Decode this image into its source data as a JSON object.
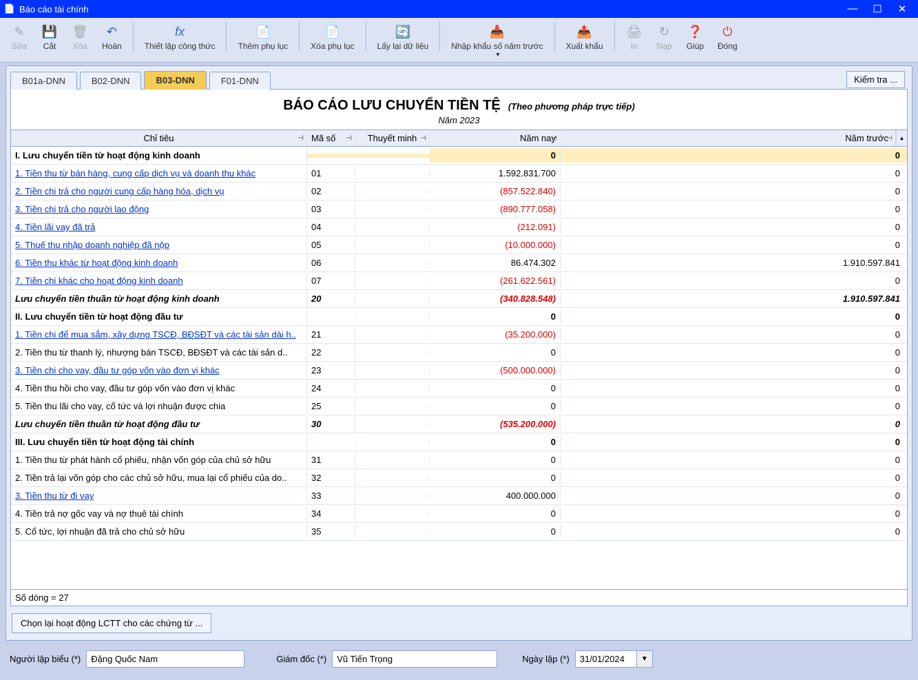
{
  "window": {
    "title": "Báo cáo tài chính"
  },
  "toolbar": {
    "edit": "Sửa",
    "cut": "Cắt",
    "del": "Xóa",
    "undo": "Hoàn",
    "formula": "Thiết lập công thức",
    "addapp": "Thêm phụ lục",
    "delapp": "Xóa phụ lục",
    "refresh": "Lấy lại dữ liệu",
    "importprev": "Nhập khẩu số năm trước",
    "export": "Xuất khẩu",
    "print": "In",
    "reload": "Nạp",
    "help": "Giúp",
    "close": "Đóng"
  },
  "tabs": {
    "t0": "B01a-DNN",
    "t1": "B02-DNN",
    "t2": "B03-DNN",
    "t3": "F01-DNN",
    "check": "Kiểm tra ..."
  },
  "report": {
    "title": "BÁO CÁO LƯU CHUYỂN TIỀN TỆ",
    "subtitle": "(Theo phương pháp trực tiếp)",
    "year": "Năm 2023"
  },
  "cols": {
    "c1": "Chỉ tiêu",
    "c2": "Mã số",
    "c3": "Thuyết minh",
    "c4": "Năm nay",
    "c5": "Năm trước"
  },
  "rows": [
    {
      "t": "I. Lưu chuyển tiền từ hoạt động kinh doanh",
      "n": "0",
      "p": "0",
      "hdr": true,
      "hl": true
    },
    {
      "t": "1. Tiền thu từ bán hàng, cung cấp dịch vụ và doanh thu khác",
      "m": "01",
      "n": "1.592.831.700",
      "p": "0",
      "link": true
    },
    {
      "t": "2. Tiền chi trả cho người cung cấp hàng hóa, dịch vụ",
      "m": "02",
      "n": "(857.522.840)",
      "p": "0",
      "link": true,
      "neg": true
    },
    {
      "t": "3. Tiền chi trả cho người lao động",
      "m": "03",
      "n": "(890.777.058)",
      "p": "0",
      "link": true,
      "neg": true
    },
    {
      "t": "4. Tiền lãi vay đã trả",
      "m": "04",
      "n": "(212.091)",
      "p": "0",
      "link": true,
      "neg": true
    },
    {
      "t": "5. Thuế thu nhập doanh nghiệp đã nộp",
      "m": "05",
      "n": "(10.000.000)",
      "p": "0",
      "link": true,
      "neg": true
    },
    {
      "t": "6. Tiền thu khác từ hoạt động kinh doanh",
      "m": "06",
      "n": "86.474.302",
      "p": "1.910.597.841",
      "link": true
    },
    {
      "t": "7. Tiền chi khác cho hoạt động kinh doanh",
      "m": "07",
      "n": "(261.622.561)",
      "p": "0",
      "link": true,
      "neg": true
    },
    {
      "t": "Lưu chuyển tiền thuần từ hoạt động kinh doanh",
      "m": "20",
      "n": "(340.828.548)",
      "p": "1.910.597.841",
      "sub": true,
      "neg": true
    },
    {
      "t": "II. Lưu chuyển tiền từ hoạt động đầu tư",
      "n": "0",
      "p": "0",
      "hdr": true
    },
    {
      "t": "1. Tiền chi để mua sắm, xây dựng TSCĐ, BĐSĐT và các tài sản dài h..",
      "m": "21",
      "n": "(35.200.000)",
      "p": "0",
      "link": true,
      "neg": true
    },
    {
      "t": "2. Tiền thu từ thanh lý, nhượng bán TSCĐ, BĐSĐT và các tài sản d..",
      "m": "22",
      "n": "0",
      "p": "0"
    },
    {
      "t": "3. Tiền chi cho vay, đầu tư góp vốn vào đơn vị khác",
      "m": "23",
      "n": "(500.000.000)",
      "p": "0",
      "link": true,
      "neg": true
    },
    {
      "t": "4. Tiền thu hồi cho vay, đầu tư góp vốn vào đơn vị khác",
      "m": "24",
      "n": "0",
      "p": "0"
    },
    {
      "t": "5. Tiền thu lãi cho vay, cổ tức và lợi nhuận được chia",
      "m": "25",
      "n": "0",
      "p": "0"
    },
    {
      "t": "Lưu chuyển tiền thuần từ hoạt động đầu tư",
      "m": "30",
      "n": "(535.200.000)",
      "p": "0",
      "sub": true,
      "neg": true
    },
    {
      "t": "III. Lưu chuyển tiền từ hoạt động tài chính",
      "n": "0",
      "p": "0",
      "hdr": true
    },
    {
      "t": "1. Tiền thu từ phát hành cổ phiếu, nhận vốn góp của chủ sở hữu",
      "m": "31",
      "n": "0",
      "p": "0"
    },
    {
      "t": "2. Tiền trả lại vốn góp cho các chủ sở hữu, mua lại cổ phiếu của do..",
      "m": "32",
      "n": "0",
      "p": "0"
    },
    {
      "t": "3. Tiền thu từ đi vay",
      "m": "33",
      "n": "400.000.000",
      "p": "0",
      "link": true
    },
    {
      "t": "4. Tiền trả nợ gốc vay và nợ thuê tài chính",
      "m": "34",
      "n": "0",
      "p": "0"
    },
    {
      "t": "5. Cổ tức, lợi nhuận đã trả cho chủ sở hữu",
      "m": "35",
      "n": "0",
      "p": "0"
    }
  ],
  "footer": {
    "rowcount": "Số dòng = 27",
    "rebtn": "Chọn lại hoạt động LCTT cho các chứng từ ..."
  },
  "bottom": {
    "l1": "Người lập biểu (*)",
    "v1": "Đặng Quốc Nam",
    "l2": "Giám đốc (*)",
    "v2": "Vũ Tiến Trọng",
    "l3": "Ngày lập (*)",
    "v3": "31/01/2024"
  }
}
